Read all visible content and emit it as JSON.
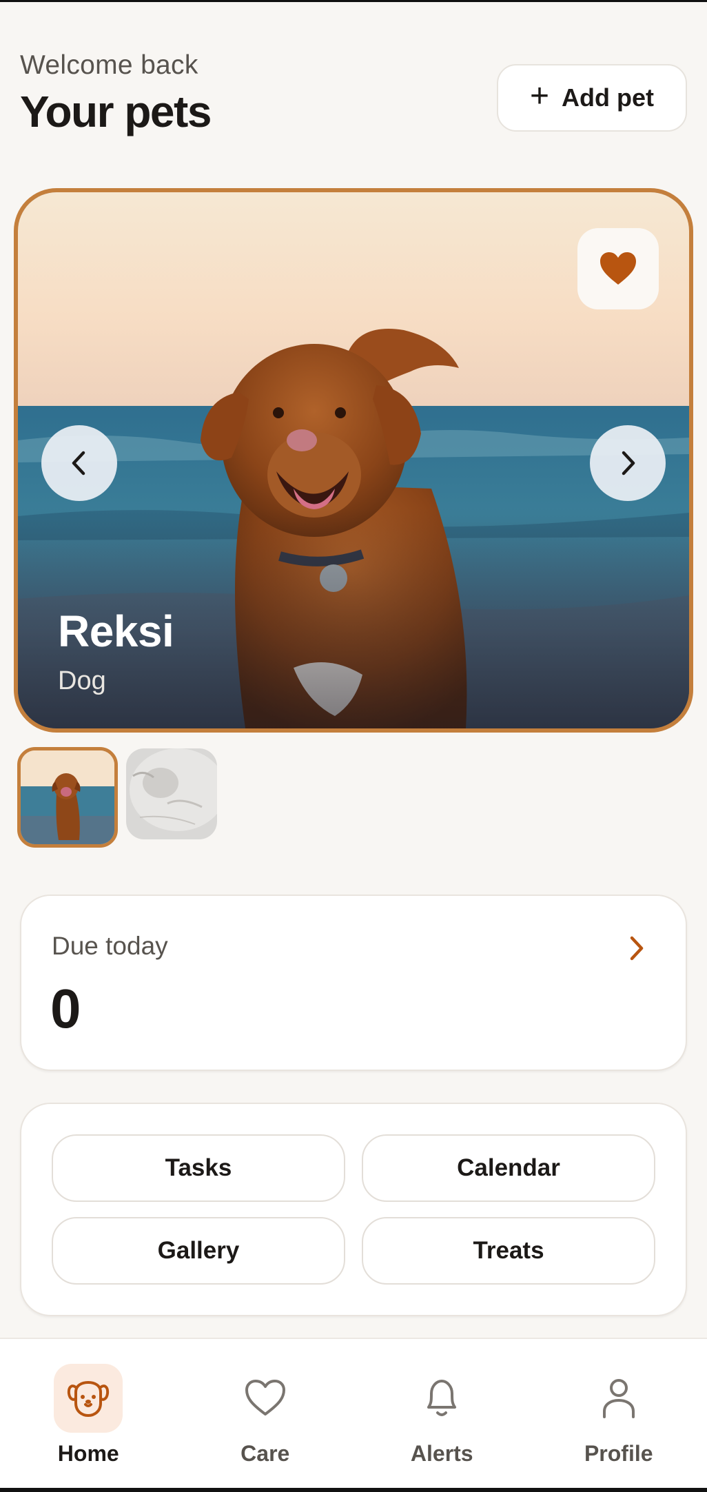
{
  "header": {
    "welcome": "Welcome back",
    "title": "Your pets",
    "add_pet_label": "Add pet",
    "add_pet_icon": "plus-icon"
  },
  "hero": {
    "pet_name": "Reksi",
    "pet_type": "Dog",
    "favorite_icon": "heart-icon",
    "prev_icon": "chevron-left-icon",
    "next_icon": "chevron-right-icon"
  },
  "thumbnails": [
    {
      "subject": "dog",
      "active": true
    },
    {
      "subject": "cat",
      "active": false
    }
  ],
  "due_today": {
    "label": "Due today",
    "count": "0"
  },
  "actions": {
    "tasks": "Tasks",
    "calendar": "Calendar",
    "gallery": "Gallery",
    "treats": "Treats"
  },
  "tabs": {
    "home": "Home",
    "care": "Care",
    "alerts": "Alerts",
    "profile": "Profile",
    "active": "home"
  },
  "colors": {
    "accent": "#c47f3c",
    "heart": "#b85510",
    "background": "#f8f6f3"
  }
}
